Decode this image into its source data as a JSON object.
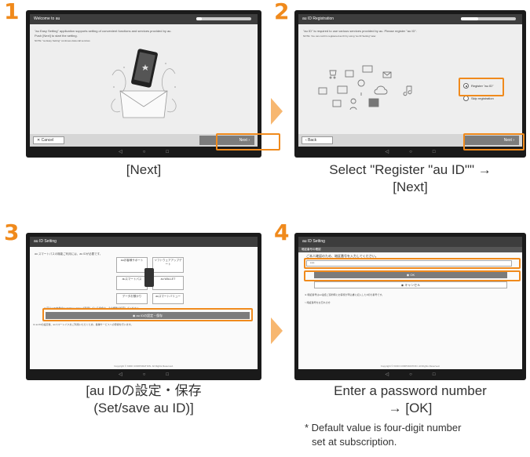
{
  "steps": [
    {
      "number": "1",
      "title": "Welcome to au",
      "body_lines": [
        "\"au Easy Setting\" application supports setting of convenient functions and services provided by au.",
        "Push [Next] to start the setting.",
        "NOTE: \"au Easy Setting\" continues data call services"
      ],
      "left_button": "Cancel",
      "right_button": "Next",
      "caption": "[Next]"
    },
    {
      "number": "2",
      "title": "au ID Registration",
      "body_lines": [
        "\"au ID\" is required to use various services provided by au. Please register \"au ID\".",
        "NOTE: You can confirm registered au ID by using \"au ID Setting\" later."
      ],
      "option_register": "Register \"au ID\"",
      "option_skip": "Skip registration",
      "left_button": "Back",
      "right_button": "Next",
      "caption_line1": "Select \"Register \"au ID\"\" →",
      "caption_line2": "[Next]"
    },
    {
      "number": "3",
      "title": "au ID Setting",
      "body_line": "au スマートパスの機能ご利用には、au IDが必要です。",
      "box_labels": [
        "auお客様サポート",
        "ソフトウェアアップデート",
        "auスマートパス",
        "au WALLET",
        "データお預かり",
        "auスマートバリュー"
      ],
      "note_line": "※ 同じauIDを他のauスマートフォンで利用している場合は、その機種で設定してください。",
      "action_button": "au IDの設定・保存",
      "footer_note": "※ au IDの設定後、auスマートパスをご利用いただくため、各種サービスへの登録を行います。",
      "copyright": "Copyright © KDDI CORPORATION. All Rights Reserved.",
      "caption_line1": "[au IDの設定・保存",
      "caption_line2": "(Set/save au ID)]"
    },
    {
      "number": "4",
      "title": "au ID Setting",
      "header": "暗証番号の確認",
      "prompt": "ご本人確認のため、暗証番号を入力してください。",
      "input_value": "****",
      "ok_button": "OK",
      "cancel_button": "キャンセル",
      "notes": "※ 暗証番号はau電話ご契約時にお客様が申込書に記入した4桁の番号です。",
      "link": "> 暗証番号をお忘れの方",
      "copyright": "Copyright © KDDI CORPORATION. All Rights Reserved.",
      "caption_line1": "Enter a password number",
      "caption_line2": "→ [OK]",
      "footnote_line1": "* Default value is four-digit number",
      "footnote_line2": "set at subscription."
    }
  ],
  "colors": {
    "accent": "#f08a1c",
    "arrow": "#f7b770",
    "titlebar": "#3d3d3d",
    "button_dark": "#7c7c7c"
  }
}
